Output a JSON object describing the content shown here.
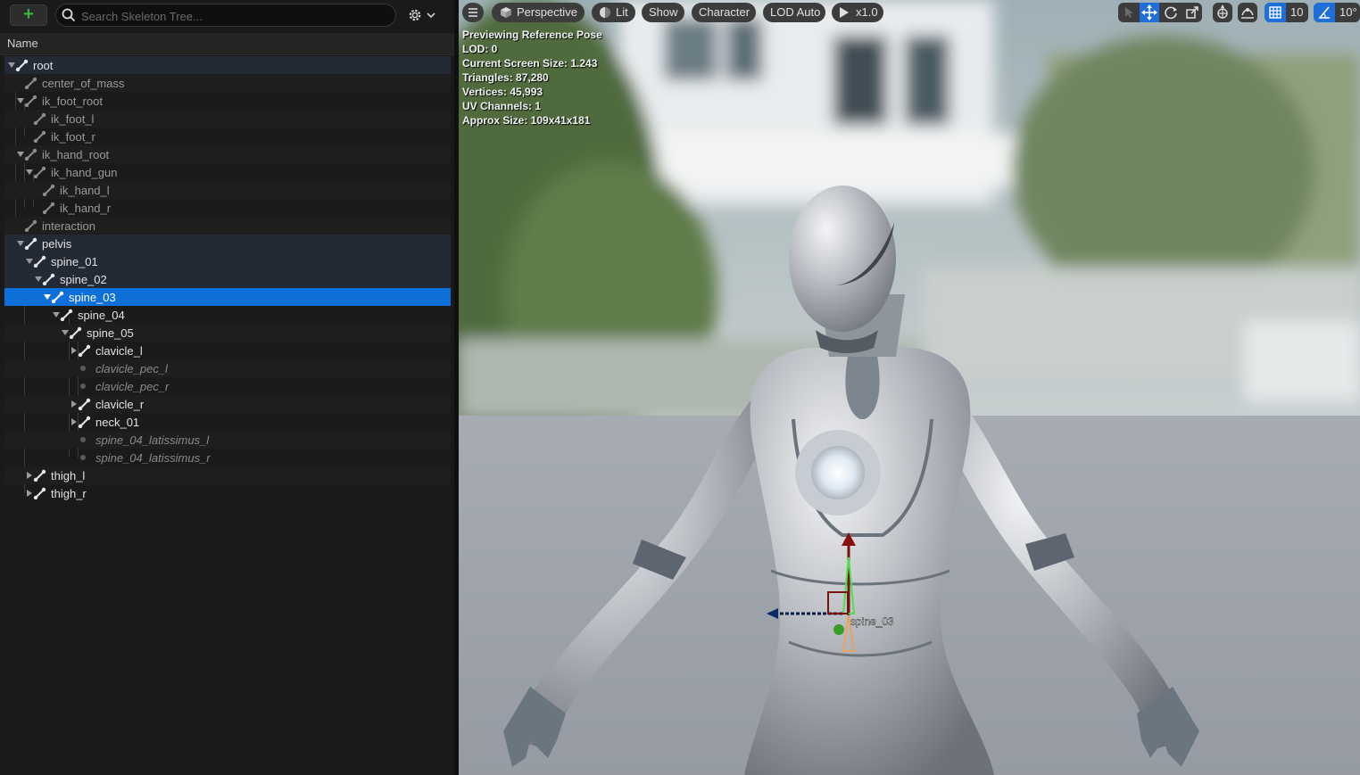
{
  "skeleton_panel": {
    "add_label": "+",
    "search": {
      "placeholder": "Search Skeleton Tree..."
    },
    "column_header": "Name"
  },
  "tree": [
    {
      "label": "root",
      "depth": 0,
      "kind": "bone",
      "expand": "open",
      "style": "main",
      "bg": "hl"
    },
    {
      "label": "center_of_mass",
      "depth": 1,
      "kind": "bone",
      "expand": "none",
      "style": "dim",
      "bg": "alt"
    },
    {
      "label": "ik_foot_root",
      "depth": 1,
      "kind": "bone",
      "expand": "open",
      "style": "dim",
      "bg": ""
    },
    {
      "label": "ik_foot_l",
      "depth": 2,
      "kind": "bone",
      "expand": "none",
      "style": "dim",
      "bg": "alt"
    },
    {
      "label": "ik_foot_r",
      "depth": 2,
      "kind": "bone",
      "expand": "none",
      "style": "dim",
      "bg": ""
    },
    {
      "label": "ik_hand_root",
      "depth": 1,
      "kind": "bone",
      "expand": "open",
      "style": "dim",
      "bg": "alt"
    },
    {
      "label": "ik_hand_gun",
      "depth": 2,
      "kind": "bone",
      "expand": "open",
      "style": "dim",
      "bg": ""
    },
    {
      "label": "ik_hand_l",
      "depth": 3,
      "kind": "bone",
      "expand": "none",
      "style": "dim",
      "bg": "alt"
    },
    {
      "label": "ik_hand_r",
      "depth": 3,
      "kind": "bone",
      "expand": "none",
      "style": "dim",
      "bg": ""
    },
    {
      "label": "interaction",
      "depth": 1,
      "kind": "bone",
      "expand": "none",
      "style": "dim",
      "bg": "alt"
    },
    {
      "label": "pelvis",
      "depth": 1,
      "kind": "bone",
      "expand": "open",
      "style": "main",
      "bg": "hl"
    },
    {
      "label": "spine_01",
      "depth": 2,
      "kind": "bone",
      "expand": "open",
      "style": "main",
      "bg": "hl"
    },
    {
      "label": "spine_02",
      "depth": 3,
      "kind": "bone",
      "expand": "open",
      "style": "main",
      "bg": "hl"
    },
    {
      "label": "spine_03",
      "depth": 4,
      "kind": "bone",
      "expand": "open",
      "style": "sel",
      "bg": "sel"
    },
    {
      "label": "spine_04",
      "depth": 5,
      "kind": "bone",
      "expand": "open",
      "style": "main",
      "bg": ""
    },
    {
      "label": "spine_05",
      "depth": 6,
      "kind": "bone",
      "expand": "open",
      "style": "main",
      "bg": "alt"
    },
    {
      "label": "clavicle_l",
      "depth": 7,
      "kind": "bone",
      "expand": "closed",
      "style": "main",
      "bg": ""
    },
    {
      "label": "clavicle_pec_l",
      "depth": 7,
      "kind": "socket",
      "expand": "none",
      "style": "sock",
      "bg": "alt"
    },
    {
      "label": "clavicle_pec_r",
      "depth": 7,
      "kind": "socket",
      "expand": "none",
      "style": "sock",
      "bg": ""
    },
    {
      "label": "clavicle_r",
      "depth": 7,
      "kind": "bone",
      "expand": "closed",
      "style": "main",
      "bg": "alt"
    },
    {
      "label": "neck_01",
      "depth": 7,
      "kind": "bone",
      "expand": "closed",
      "style": "main",
      "bg": ""
    },
    {
      "label": "spine_04_latissimus_l",
      "depth": 7,
      "kind": "socket",
      "expand": "none",
      "style": "sock",
      "bg": "alt"
    },
    {
      "label": "spine_04_latissimus_r",
      "depth": 7,
      "kind": "socket",
      "expand": "none",
      "style": "sock",
      "bg": ""
    },
    {
      "label": "thigh_l",
      "depth": 2,
      "kind": "bone",
      "expand": "closed",
      "style": "main",
      "bg": "alt"
    },
    {
      "label": "thigh_r",
      "depth": 2,
      "kind": "bone",
      "expand": "closed",
      "style": "main",
      "bg": ""
    }
  ],
  "viewport": {
    "toolbar": {
      "perspective": "Perspective",
      "lit": "Lit",
      "show": "Show",
      "character": "Character",
      "lod": "LOD Auto",
      "speed": "x1.0",
      "grid_snap": "10",
      "angle_snap": "10°"
    },
    "stats": [
      "Previewing Reference Pose",
      "LOD: 0",
      "Current Screen Size: 1.243",
      "Triangles: 87,280",
      "Vertices: 45,993",
      "UV Channels: 1",
      "Approx Size: 109x41x181"
    ],
    "gizmo_label": "spine_03"
  },
  "colors": {
    "selection": "#0d70d8",
    "accent_green": "#39b53a",
    "active_tool": "#1f6fd8"
  }
}
